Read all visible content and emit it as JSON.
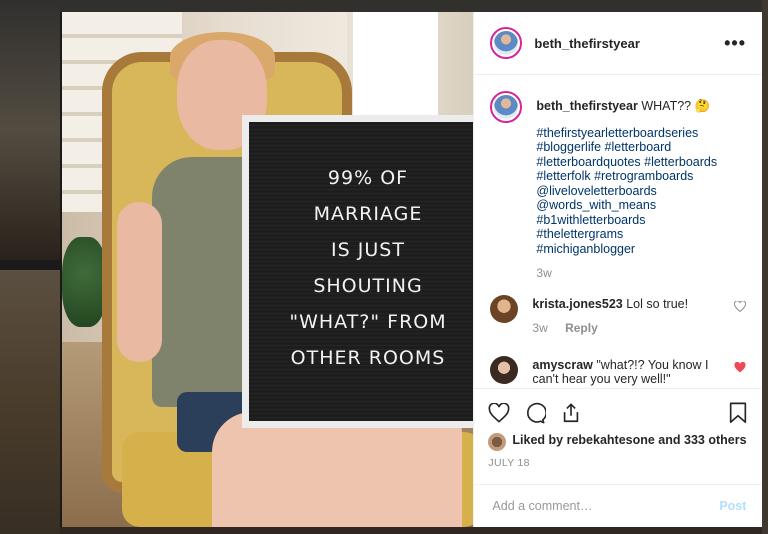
{
  "colors": {
    "text": "#262626",
    "muted": "#8e8e8e",
    "hashtag": "#003569",
    "like_red": "#ed4956",
    "post_disabled": "#b2dffc",
    "story_ring": "#d6249f"
  },
  "post": {
    "username": "beth_thefirstyear",
    "more_icon": "more-horizontal-icon",
    "board_lines": [
      "99% OF",
      "MARRIAGE",
      "IS JUST",
      "SHOUTING",
      "\"WHAT?\" FROM",
      "OTHER ROOMS"
    ],
    "caption": {
      "username": "beth_thefirstyear",
      "text": "WHAT?? 🤔",
      "hashtags": [
        "#thefirstyearletterboardseries",
        "#bloggerlife #letterboard",
        "#letterboardquotes #letterboards",
        "#letterfolk #retrogramboards",
        "@liveloveletterboards",
        "@words_with_means",
        "#b1withletterboards",
        "#thelettergrams",
        "#michiganblogger"
      ],
      "time": "3w"
    },
    "comments": [
      {
        "username": "krista.jones523",
        "text": "Lol so true!",
        "time": "3w",
        "reply": "Reply",
        "liked": false
      },
      {
        "username": "amyscraw",
        "text": "\"what?!? You know I can't hear you very well!\"",
        "liked": true
      }
    ],
    "likes_text": "Liked by rebekahtesone and 333 others",
    "date": "JULY 18",
    "add_comment_placeholder": "Add a comment…",
    "post_button": "Post"
  }
}
